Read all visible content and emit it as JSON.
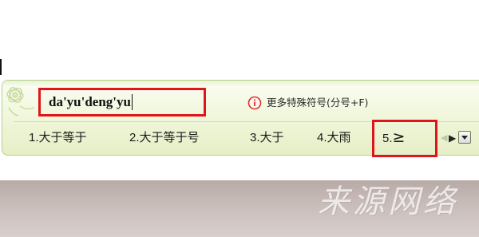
{
  "ime": {
    "composition_text": "da'yu'deng'yu",
    "more_symbols_label": "更多特殊符号(分号+F)",
    "candidates": [
      {
        "number": "1.",
        "text": "大于等于"
      },
      {
        "number": "2.",
        "text": "大于等于号"
      },
      {
        "number": "3.",
        "text": "大于"
      },
      {
        "number": "4.",
        "text": "大雨"
      },
      {
        "number": "5.",
        "text": "≥"
      }
    ],
    "icons": {
      "info": "info-circle-icon",
      "prev": "triangle-left-icon",
      "next": "triangle-right-icon",
      "dropdown": "chevron-down-icon",
      "logo": "flower-icon"
    }
  },
  "colors": {
    "highlight_red": "#e0141b",
    "ime_background": "#f1f7dd",
    "ime_border": "#b7cf8c"
  },
  "watermark_text": "来源网络"
}
